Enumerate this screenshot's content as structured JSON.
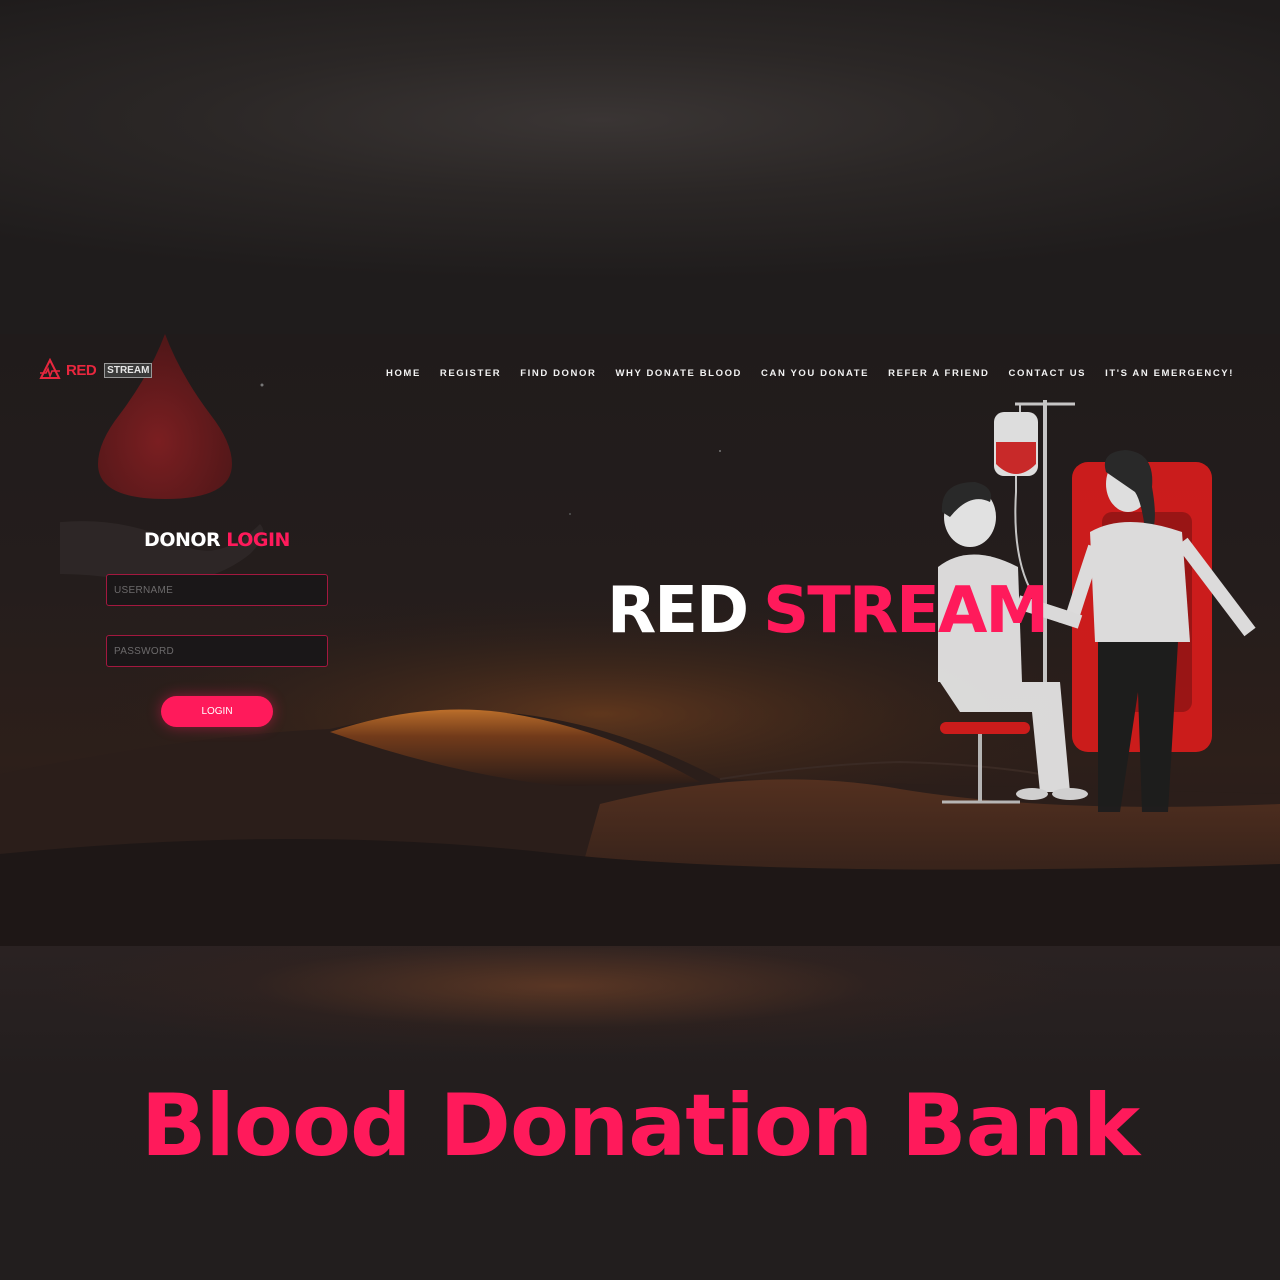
{
  "brand": {
    "logo_red": "RED",
    "logo_stream": "STREAM",
    "accent_color": "#ff1a5b",
    "logo_color": "#e8273e"
  },
  "nav": {
    "items": [
      "HOME",
      "REGISTER",
      "FIND DONOR",
      "WHY DONATE BLOOD",
      "CAN YOU DONATE",
      "REFER A FRIEND",
      "CONTACT US",
      "IT'S AN EMERGENCY!"
    ]
  },
  "login": {
    "title_word1": "DONOR",
    "title_word2": "LOGIN",
    "username_placeholder": "USERNAME",
    "password_placeholder": "PASSWORD",
    "button_label": "LOGIN"
  },
  "hero": {
    "word1": "RED",
    "word2": "STREAM"
  },
  "caption": {
    "text": "Blood Donation Bank"
  },
  "icons": [
    "blood-drop-icon",
    "heartbeat-logo-icon"
  ]
}
